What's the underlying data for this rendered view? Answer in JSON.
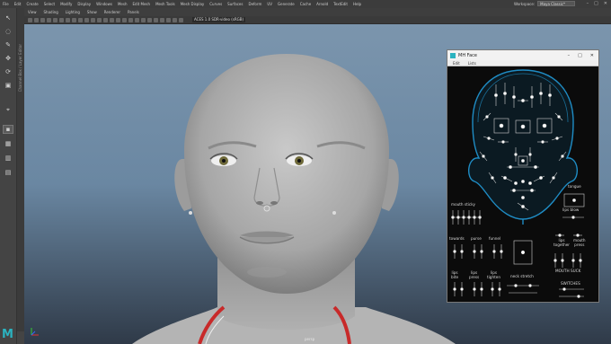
{
  "menubar": {
    "items": [
      "File",
      "Edit",
      "Create",
      "Select",
      "Modify",
      "Display",
      "Windows",
      "Mesh",
      "Edit Mesh",
      "Mesh Tools",
      "Mesh Display",
      "Curves",
      "Surfaces",
      "Deform",
      "UV",
      "Generate",
      "Cache",
      "Arnold",
      "TextEdit",
      "Help"
    ],
    "workspace_label": "Workspace:",
    "workspace_value": "Maya Classic*"
  },
  "viewport": {
    "menu": [
      "View",
      "Shading",
      "Lighting",
      "Show",
      "Renderer",
      "Panels"
    ],
    "gamma_text": "ACES 1.0 SDR-video (sRGB)",
    "camera_label": "persp"
  },
  "side_tab_label": "Channel Box / Layer Editor",
  "logo_text": "M",
  "mh_panel": {
    "title": "MH Face",
    "menu": [
      "Edit",
      "Lists"
    ],
    "labels": {
      "mouth_sticky": "mouth sticky",
      "tongue": "tongue",
      "lips_blow": "lips blow",
      "towards": "towards",
      "purse": "purse",
      "funnel": "funnel",
      "lips_together": "lips\ntogether",
      "mouth_press": "mouth\npress",
      "lips_bite": "lips\nbite",
      "lips_press": "lips\npress",
      "lips_tighten": "lips\ntighten",
      "neck_stretch": "neck stretch",
      "mouth_suck": "MOUTH SUCK",
      "switches": "SWITCHES"
    }
  },
  "colors": {
    "viewport_top": "#7b95ad",
    "viewport_bottom": "#2f3a48",
    "panel_bg": "#0b0b0b",
    "panel_outline": "#1f8cc4",
    "accent": "#2bb3c0",
    "necklace": "#c82a2a"
  }
}
